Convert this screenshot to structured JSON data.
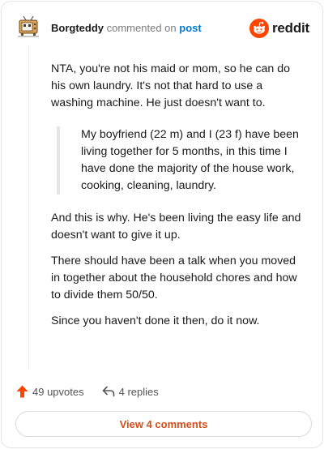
{
  "comment": {
    "username": "Borgteddy",
    "commented_on": "commented on",
    "post_link": "post"
  },
  "brand": {
    "name": "reddit",
    "icon": "reddit-alien-icon",
    "color": "#ff4500"
  },
  "body": {
    "para1": "NTA, you're not his maid or mom, so he can do his own laundry. It's not that hard to use a washing machine. He just doesn't want to.",
    "quote": "My boyfriend (22 m) and I (23 f) have been living together for 5 months, in this time I have done the majority of the house work, cooking, cleaning, laundry.",
    "para2": "And this is why. He's been living the easy life and doesn't want to give it up.",
    "para3": "There should have been a talk when you moved in together about the household chores and how to divide them 50/50.",
    "para4": "Since you haven't done it then, do it now."
  },
  "actions": {
    "upvotes": "49 upvotes",
    "replies": "4 replies"
  },
  "footer": {
    "view_comments": "View 4 comments",
    "accent": "#d14f1a"
  }
}
